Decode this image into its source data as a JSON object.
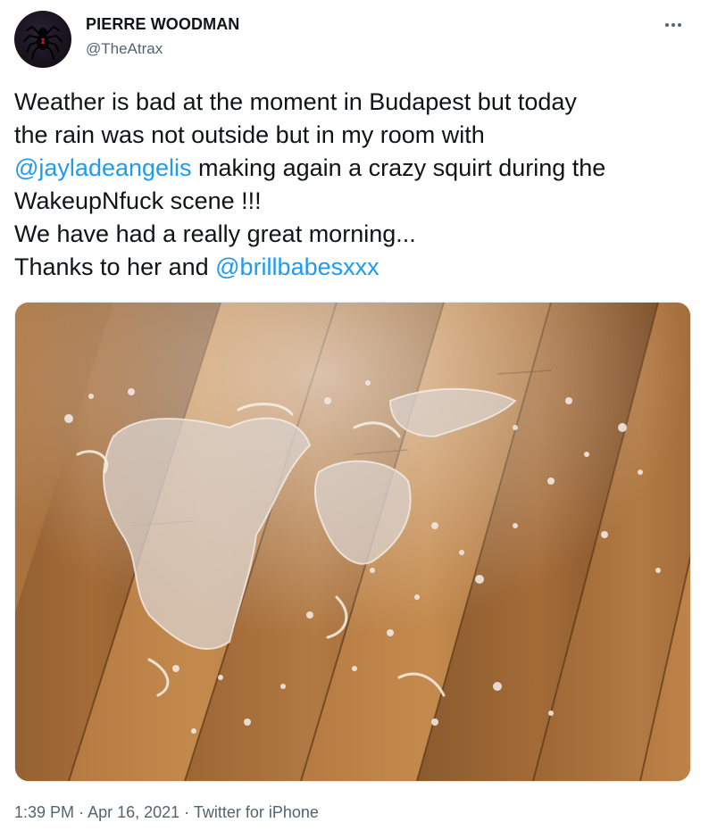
{
  "author": {
    "name": "PIERRE WOODMAN",
    "handle": "@TheAtrax",
    "avatar_icon": "spider-icon"
  },
  "tweet": {
    "line1": "Weather is bad at the moment in Budapest but today",
    "line2": "the rain was not outside but in my room with",
    "mention1": "@jayladeangelis",
    "line3_rest": " making again a crazy squirt during the",
    "line4": "WakeupNfuck scene !!!",
    "line5": "We have had a really great morning...",
    "line6_start": "Thanks to her and ",
    "mention2": "@brillbabesxxx"
  },
  "meta": {
    "time": "1:39 PM",
    "separator": "·",
    "date": "Apr 16, 2021",
    "source": "Twitter for iPhone"
  },
  "colors": {
    "link": "#1d9bf0",
    "muted": "#536471",
    "text": "#0f1419"
  },
  "more_icon": "more-horizontal-icon"
}
